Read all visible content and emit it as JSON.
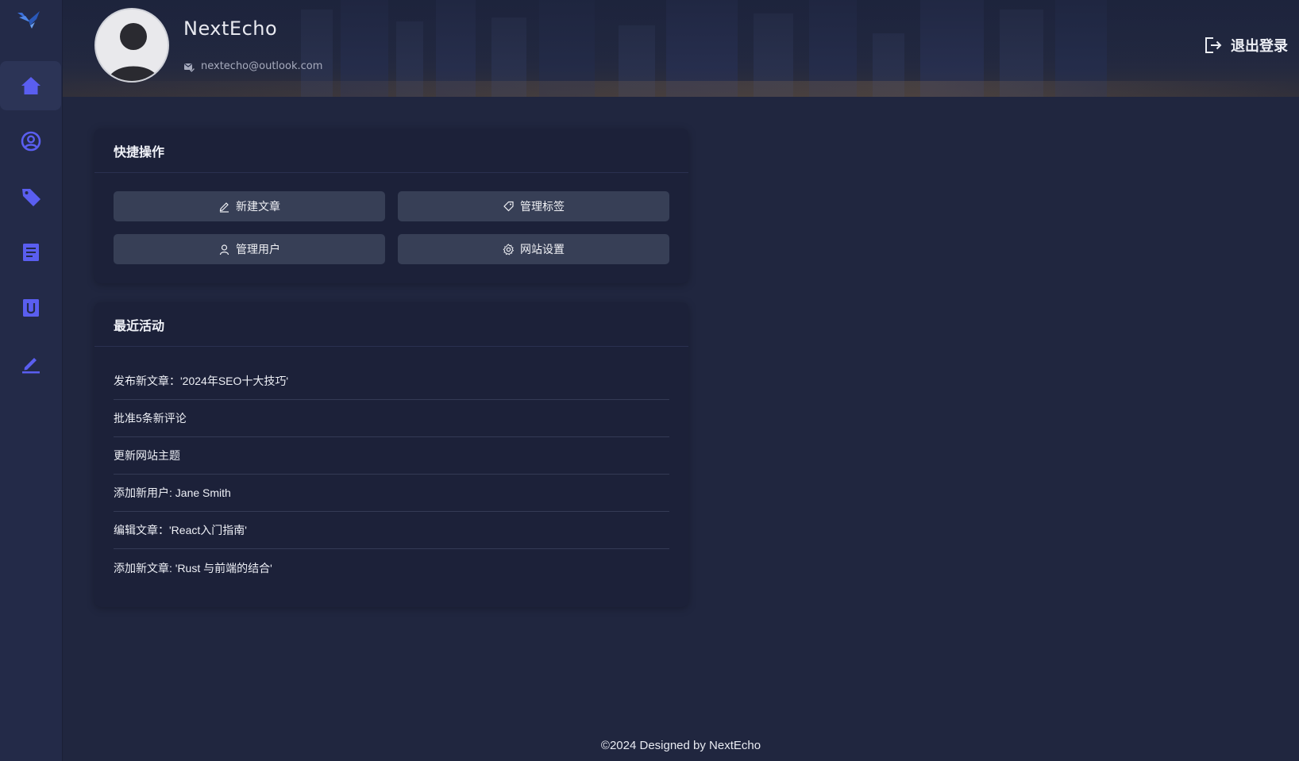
{
  "sidebar": {
    "items": [
      {
        "icon": "home-icon",
        "active": true
      },
      {
        "icon": "user-circle-icon",
        "active": false
      },
      {
        "icon": "tag-icon",
        "active": false
      },
      {
        "icon": "document-icon",
        "active": false
      },
      {
        "icon": "archive-icon",
        "active": false
      },
      {
        "icon": "edit-icon",
        "active": false
      }
    ],
    "accent": "#5a5ef0"
  },
  "header": {
    "username": "NextEcho",
    "email": "nextecho@outlook.com",
    "logout_label": "退出登录"
  },
  "quick_actions": {
    "title": "快捷操作",
    "buttons": [
      {
        "label": "新建文章",
        "icon": "pencil-icon"
      },
      {
        "label": "管理标签",
        "icon": "tag-icon"
      },
      {
        "label": "管理用户",
        "icon": "user-icon"
      },
      {
        "label": "网站设置",
        "icon": "gear-icon"
      }
    ]
  },
  "recent_activity": {
    "title": "最近活动",
    "items": [
      "发布新文章：'2024年SEO十大技巧'",
      "批准5条新评论",
      "更新网站主题",
      "添加新用户: Jane Smith",
      "编辑文章：'React入门指南'",
      "添加新文章: 'Rust 与前端的结合'"
    ]
  },
  "footer": {
    "text": "©2024 Designed by NextEcho"
  }
}
